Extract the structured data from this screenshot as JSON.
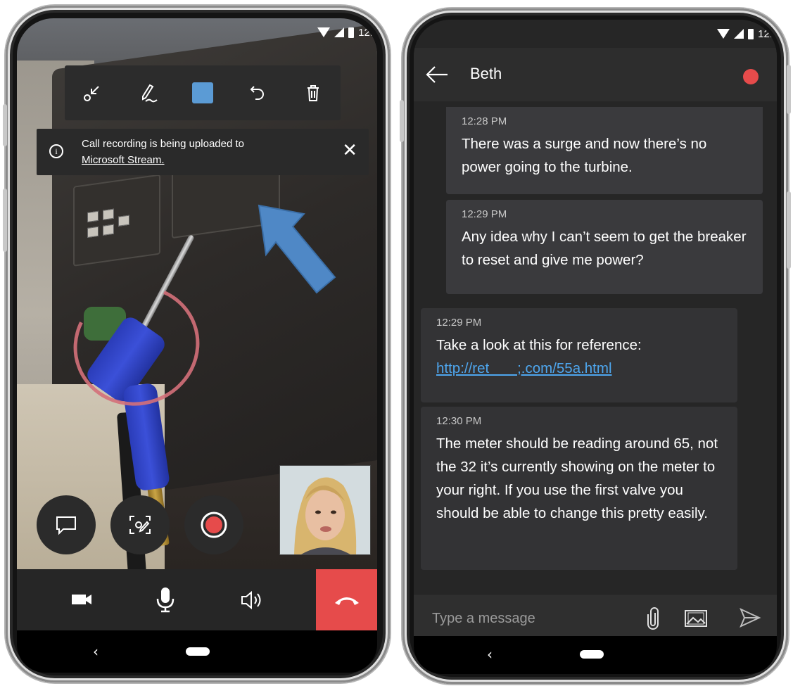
{
  "status_bar": {
    "time_left": "12:",
    "time_right": "12:"
  },
  "call": {
    "banner": {
      "text": "Call recording is being uploaded to",
      "link": "Microsoft Stream."
    },
    "toolbar": [
      "collapse-icon",
      "pen-icon",
      "color-swatch",
      "undo-icon",
      "trash-icon"
    ],
    "toolbar_color": "#5b9bd5",
    "annotation_colors": {
      "circle": "#d4707a",
      "arrow": "#4f88c6"
    },
    "end_call_color": "#e64b4b"
  },
  "chat": {
    "contact": "Beth",
    "messages": [
      {
        "time": "12:28 PM",
        "text": "There was a surge and now there’s no power going to the turbine."
      },
      {
        "time": "12:29 PM",
        "text": "Any idea why I can’t seem to get the breaker to reset and give me power?"
      },
      {
        "time": "12:29 PM",
        "text": "Take a look at this for reference:",
        "link": "http://ret       ;.com/55a.html"
      },
      {
        "time": "12:30 PM",
        "text": "The meter should be reading around 65, not the 32 it’s currently showing on the meter to your right. If you use the first valve you should be able to change this pretty easily."
      }
    ],
    "compose_placeholder": "Type a message"
  }
}
